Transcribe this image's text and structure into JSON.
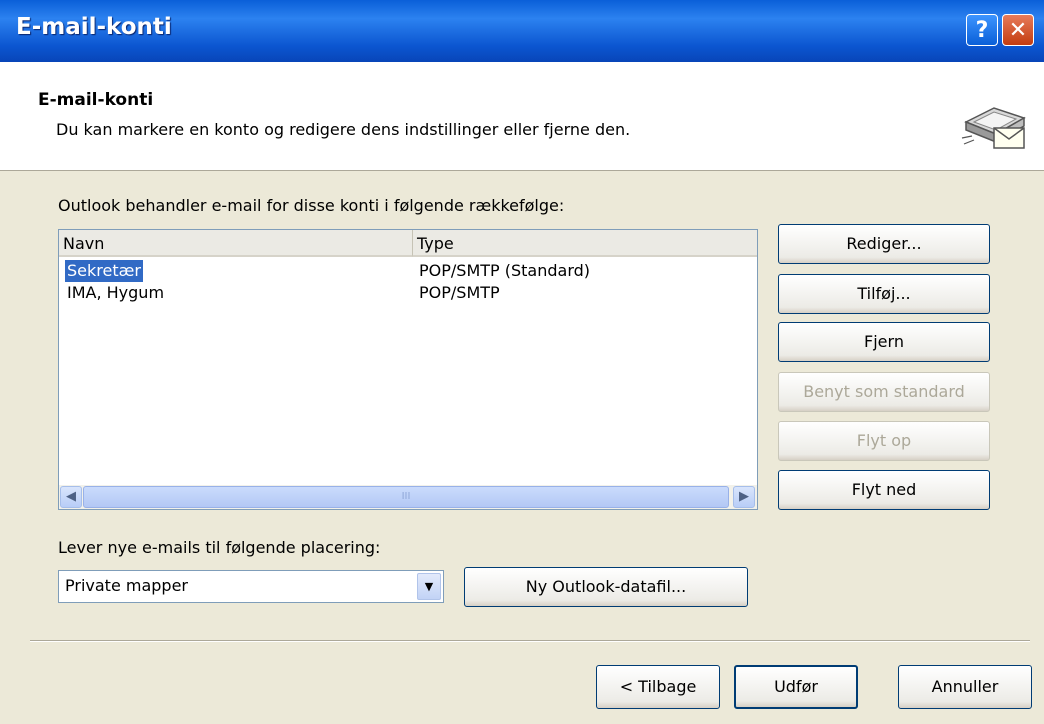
{
  "window": {
    "title": "E-mail-konti",
    "help_glyph": "?",
    "close_glyph": "✕"
  },
  "header": {
    "title": "E-mail-konti",
    "subtitle": "Du kan markere en konto og redigere dens indstillinger eller fjerne den."
  },
  "accounts": {
    "label": "Outlook behandler e-mail for disse konti i følgende rækkefølge:",
    "columns": [
      "Navn",
      "Type"
    ],
    "rows": [
      {
        "name": "Sekretær",
        "type": "POP/SMTP (Standard)",
        "selected": true
      },
      {
        "name": "IMA, Hygum",
        "type": "POP/SMTP",
        "selected": false
      }
    ],
    "scroll_left": "◀",
    "scroll_right": "▶",
    "scroll_grip": "III"
  },
  "buttons": {
    "edit": "Rediger...",
    "add": "Tilføj...",
    "remove": "Fjern",
    "set_default": "Benyt som standard",
    "move_up": "Flyt op",
    "move_down": "Flyt ned"
  },
  "delivery": {
    "label": "Lever nye e-mails til følgende placering:",
    "location": "Private mapper",
    "new_datafile_label": "Ny Outlook-datafil..."
  },
  "footer": {
    "back_label": "< Tilbage",
    "finish_label": "Udfør",
    "cancel_label": "Annuller"
  },
  "icons": {
    "header": "email-accounts-icon",
    "combo_arrow": "▼"
  },
  "colors": {
    "titlebar": "#0A5FD8",
    "selection": "#316AC5",
    "dialog_bg": "#ECE9D8"
  }
}
